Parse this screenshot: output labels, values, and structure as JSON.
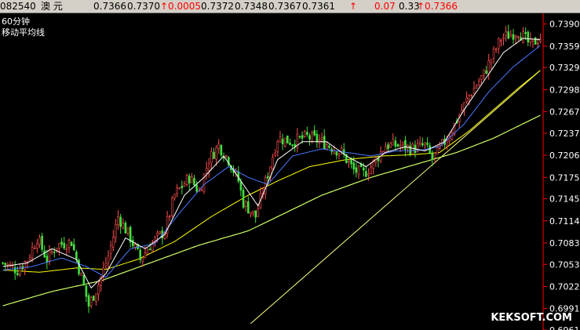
{
  "quote_bar": {
    "code": "082540",
    "name": "澳 元",
    "open": "0.7366",
    "high": "0.7370",
    "change": "↑0.0005",
    "val4": "0.7372",
    "low": "0.7348",
    "val6": "0.7367",
    "val7": "0.7361",
    "arrow": "↑",
    "val8": "0.07",
    "val9": "0.33",
    "val10": "↑0.7366"
  },
  "chart_labels": {
    "period": "60分钟",
    "indicator": "移动平均线",
    "watermark": "KEKSOFT.COM"
  },
  "colors": {
    "up_candle": "#ff5050",
    "down_candle": "#40e040",
    "ma_short": "#ffffff",
    "ma_mid": "#ffff00",
    "ma_blue": "#4a78ff",
    "ma_long": "#ccff66",
    "trend": "#ffff80",
    "axis": "#ff0000",
    "text": "#ffffff"
  },
  "chart_data": {
    "type": "candlestick",
    "title": "",
    "xlabel": "",
    "ylabel": "",
    "ylim": [
      0.6961,
      0.7405
    ],
    "y_ticks": [
      "0.7390",
      "0.7359",
      "0.7329",
      "0.7298",
      "0.7267",
      "0.7237",
      "0.7206",
      "0.7175",
      "0.7145",
      "0.7114",
      "0.7083",
      "0.7053",
      "0.7022",
      "0.6991",
      "0.6961"
    ],
    "candle_count": 220,
    "close_path": [
      [
        0,
        0.7055
      ],
      [
        6,
        0.7045
      ],
      [
        10,
        0.706
      ],
      [
        14,
        0.709
      ],
      [
        18,
        0.706
      ],
      [
        22,
        0.708
      ],
      [
        28,
        0.7085
      ],
      [
        32,
        0.7035
      ],
      [
        35,
        0.6995
      ],
      [
        39,
        0.7025
      ],
      [
        43,
        0.7065
      ],
      [
        47,
        0.712
      ],
      [
        52,
        0.709
      ],
      [
        56,
        0.706
      ],
      [
        60,
        0.708
      ],
      [
        66,
        0.71
      ],
      [
        70,
        0.715
      ],
      [
        76,
        0.7175
      ],
      [
        80,
        0.7155
      ],
      [
        84,
        0.72
      ],
      [
        88,
        0.722
      ],
      [
        92,
        0.72
      ],
      [
        96,
        0.717
      ],
      [
        98,
        0.714
      ],
      [
        103,
        0.712
      ],
      [
        108,
        0.718
      ],
      [
        112,
        0.723
      ],
      [
        118,
        0.7225
      ],
      [
        124,
        0.7232
      ],
      [
        130,
        0.7225
      ],
      [
        138,
        0.721
      ],
      [
        143,
        0.7185
      ],
      [
        147,
        0.718
      ],
      [
        150,
        0.719
      ],
      [
        156,
        0.722
      ],
      [
        162,
        0.722
      ],
      [
        167,
        0.7215
      ],
      [
        172,
        0.722
      ],
      [
        175,
        0.72
      ],
      [
        178,
        0.7215
      ],
      [
        182,
        0.7235
      ],
      [
        190,
        0.729
      ],
      [
        196,
        0.732
      ],
      [
        203,
        0.737
      ],
      [
        210,
        0.738
      ],
      [
        215,
        0.736
      ],
      [
        219,
        0.7372
      ]
    ],
    "ma_short": [
      [
        0,
        0.705
      ],
      [
        10,
        0.7055
      ],
      [
        20,
        0.7075
      ],
      [
        30,
        0.706
      ],
      [
        36,
        0.702
      ],
      [
        42,
        0.704
      ],
      [
        50,
        0.709
      ],
      [
        58,
        0.7075
      ],
      [
        66,
        0.7095
      ],
      [
        74,
        0.715
      ],
      [
        82,
        0.7175
      ],
      [
        90,
        0.7205
      ],
      [
        98,
        0.7165
      ],
      [
        104,
        0.7135
      ],
      [
        112,
        0.72
      ],
      [
        122,
        0.7225
      ],
      [
        132,
        0.7225
      ],
      [
        140,
        0.7205
      ],
      [
        148,
        0.719
      ],
      [
        156,
        0.721
      ],
      [
        164,
        0.7218
      ],
      [
        172,
        0.7212
      ],
      [
        180,
        0.7225
      ],
      [
        188,
        0.727
      ],
      [
        196,
        0.731
      ],
      [
        204,
        0.735
      ],
      [
        212,
        0.737
      ],
      [
        219,
        0.7368
      ]
    ],
    "ma_blue": [
      [
        0,
        0.7045
      ],
      [
        12,
        0.705
      ],
      [
        24,
        0.7062
      ],
      [
        34,
        0.705
      ],
      [
        42,
        0.7035
      ],
      [
        52,
        0.7075
      ],
      [
        62,
        0.7082
      ],
      [
        72,
        0.7125
      ],
      [
        82,
        0.7165
      ],
      [
        92,
        0.719
      ],
      [
        100,
        0.7175
      ],
      [
        108,
        0.7165
      ],
      [
        118,
        0.7205
      ],
      [
        130,
        0.7215
      ],
      [
        140,
        0.721
      ],
      [
        150,
        0.7205
      ],
      [
        160,
        0.7212
      ],
      [
        170,
        0.7213
      ],
      [
        178,
        0.7218
      ],
      [
        188,
        0.725
      ],
      [
        198,
        0.7295
      ],
      [
        208,
        0.733
      ],
      [
        219,
        0.736
      ]
    ],
    "ma_mid": [
      [
        0,
        0.7045
      ],
      [
        15,
        0.7042
      ],
      [
        30,
        0.7048
      ],
      [
        42,
        0.7046
      ],
      [
        55,
        0.706
      ],
      [
        70,
        0.7085
      ],
      [
        85,
        0.712
      ],
      [
        100,
        0.715
      ],
      [
        112,
        0.717
      ],
      [
        125,
        0.719
      ],
      [
        140,
        0.72
      ],
      [
        155,
        0.7205
      ],
      [
        168,
        0.7207
      ],
      [
        178,
        0.721
      ],
      [
        190,
        0.724
      ],
      [
        200,
        0.727
      ],
      [
        210,
        0.73
      ],
      [
        219,
        0.7325
      ]
    ],
    "ma_long": [
      [
        0,
        0.6995
      ],
      [
        20,
        0.7015
      ],
      [
        40,
        0.703
      ],
      [
        60,
        0.7055
      ],
      [
        80,
        0.708
      ],
      [
        100,
        0.71
      ],
      [
        115,
        0.7125
      ],
      [
        130,
        0.715
      ],
      [
        150,
        0.7175
      ],
      [
        170,
        0.7195
      ],
      [
        185,
        0.721
      ],
      [
        200,
        0.723
      ],
      [
        219,
        0.7262
      ]
    ],
    "trendline": [
      [
        101,
        0.697
      ],
      [
        219,
        0.7325
      ]
    ]
  }
}
